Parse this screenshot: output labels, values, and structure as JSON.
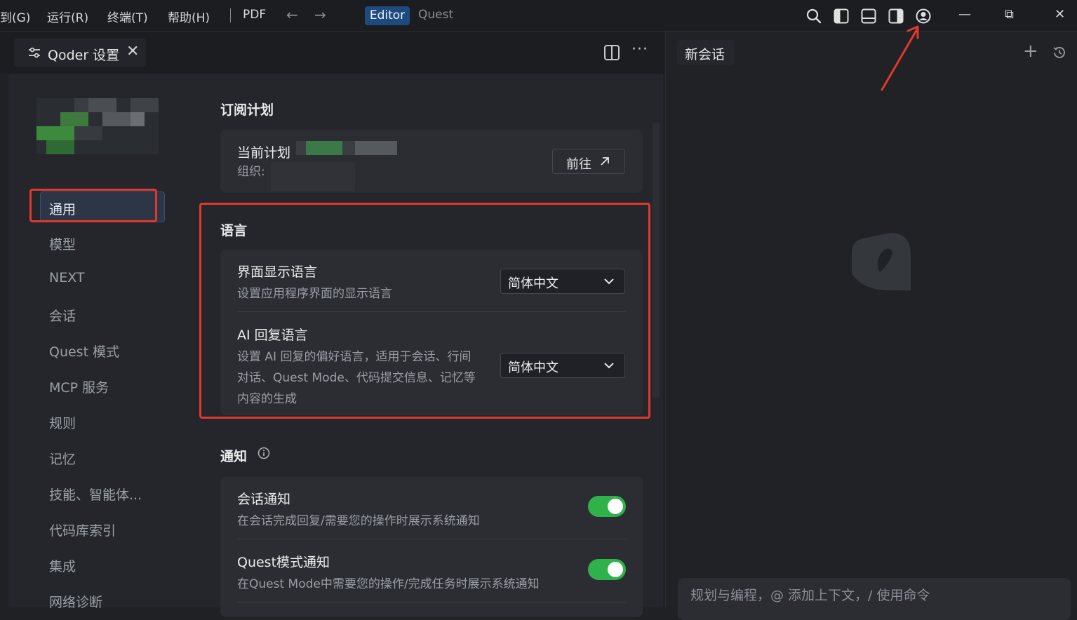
{
  "titlebar": {
    "menu": [
      "到(G)",
      "运行(R)",
      "终端(T)",
      "帮助(H)",
      "PDF"
    ],
    "back_glyph": "←",
    "forward_glyph": "→",
    "mode_tabs": {
      "editor": "Editor",
      "quest": "Quest"
    },
    "icons": [
      "search-icon",
      "toggle-left-panel-icon",
      "toggle-bottom-panel-icon",
      "toggle-right-panel-icon",
      "account-icon"
    ],
    "window_controls": {
      "minimize": "—",
      "restore": "⧉",
      "close": "✕"
    },
    "accent_color": "#1e4a7e"
  },
  "editor_tab": {
    "title": "Qoder 设置",
    "close": "✕",
    "more": "···"
  },
  "sidebar": {
    "items": [
      "通用",
      "模型",
      "NEXT",
      "会话",
      "Quest 模式",
      "MCP 服务",
      "规则",
      "记忆",
      "技能、智能体...",
      "代码库索引",
      "集成",
      "网络诊断"
    ],
    "active": "通用"
  },
  "subscription": {
    "section_title": "订阅计划",
    "current_plan_label": "当前计划",
    "org_label": "组织:",
    "goto_button": "前往"
  },
  "language": {
    "section_title": "语言",
    "ui_language": {
      "title": "界面显示语言",
      "desc": "设置应用程序界面的显示语言",
      "value": "简体中文"
    },
    "ai_language": {
      "title": "AI 回复语言",
      "desc_lines": [
        "设置 AI 回复的偏好语言，适用于会话、行间",
        "对话、Quest Mode、代码提交信息、记忆等",
        "内容的生成"
      ],
      "value": "简体中文"
    }
  },
  "notifications": {
    "section_title": "通知",
    "info_icon": "info-icon",
    "items": [
      {
        "title": "会话通知",
        "desc": "在会话完成回复/需要您的操作时展示系统通知",
        "enabled": true
      },
      {
        "title": "Quest模式通知",
        "desc": "在Quest Mode中需要您的操作/完成任务时展示系统通知",
        "enabled": true
      }
    ],
    "toggle_color": "#2fb24a"
  },
  "chat": {
    "tab_title": "新会话",
    "new_button": "+",
    "input_placeholder": "规划与编程，@ 添加上下文，/ 使用命令"
  },
  "annotation_color": "#e0382c"
}
